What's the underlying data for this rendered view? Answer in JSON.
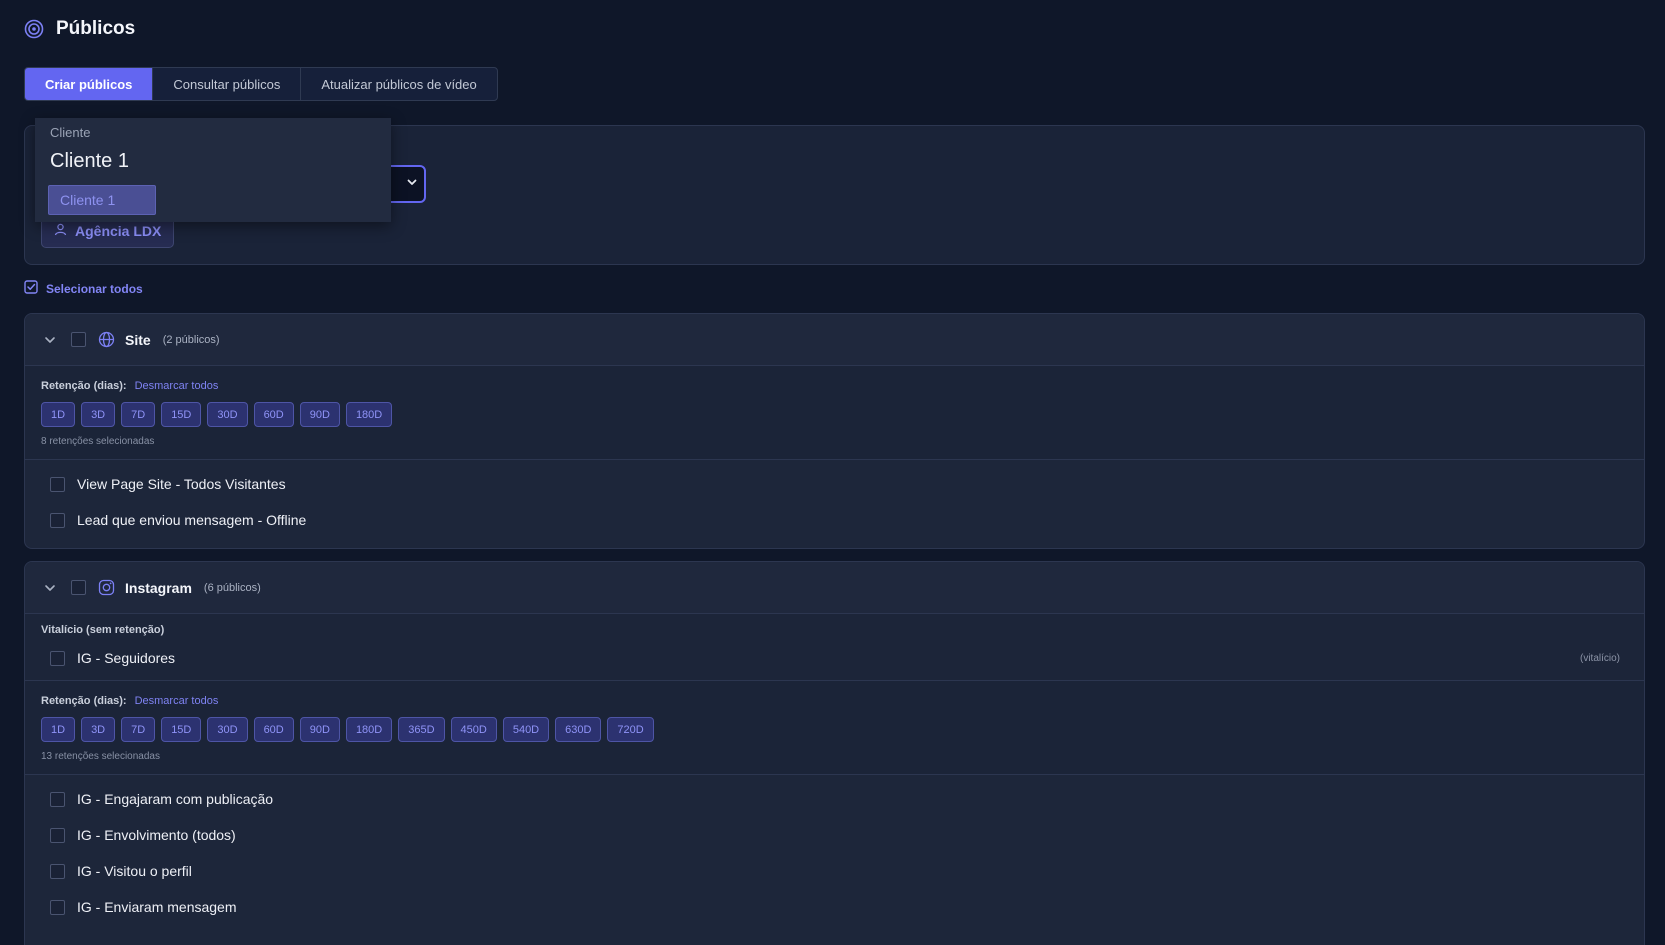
{
  "page": {
    "title": "Públicos"
  },
  "tabs": [
    {
      "label": "Criar públicos"
    },
    {
      "label": "Consultar públicos"
    },
    {
      "label": "Atualizar públicos de vídeo"
    }
  ],
  "client": {
    "dropdown_label": "Cliente",
    "dropdown_value": "Cliente 1",
    "dropdown_option": "Cliente 1",
    "agency": "Agência LDX"
  },
  "select_all": "Selecionar todos",
  "site": {
    "title": "Site",
    "count": "(2 públicos)",
    "retention_label": "Retenção (dias):",
    "deselect_label": "Desmarcar todos",
    "chips": [
      "1D",
      "3D",
      "7D",
      "15D",
      "30D",
      "60D",
      "90D",
      "180D"
    ],
    "selected_text": "8 retenções selecionadas",
    "items": [
      "View Page Site - Todos Visitantes",
      "Lead que enviou mensagem - Offline"
    ]
  },
  "instagram": {
    "title": "Instagram",
    "count": "(6 públicos)",
    "vital_title": "Vitalício (sem retenção)",
    "vital_item": "IG - Seguidores",
    "vital_note": "(vitalício)",
    "retention_label": "Retenção (dias):",
    "deselect_label": "Desmarcar todos",
    "chips": [
      "1D",
      "3D",
      "7D",
      "15D",
      "30D",
      "60D",
      "90D",
      "180D",
      "365D",
      "450D",
      "540D",
      "630D",
      "720D"
    ],
    "selected_text": "13 retenções selecionadas",
    "items": [
      "IG - Engajaram com publicação",
      "IG - Envolvimento (todos)",
      "IG - Visitou o perfil",
      "IG - Enviaram mensagem"
    ]
  },
  "colors": {
    "accent": "#6366f1",
    "background": "#0f1729",
    "card": "#1d263a"
  }
}
